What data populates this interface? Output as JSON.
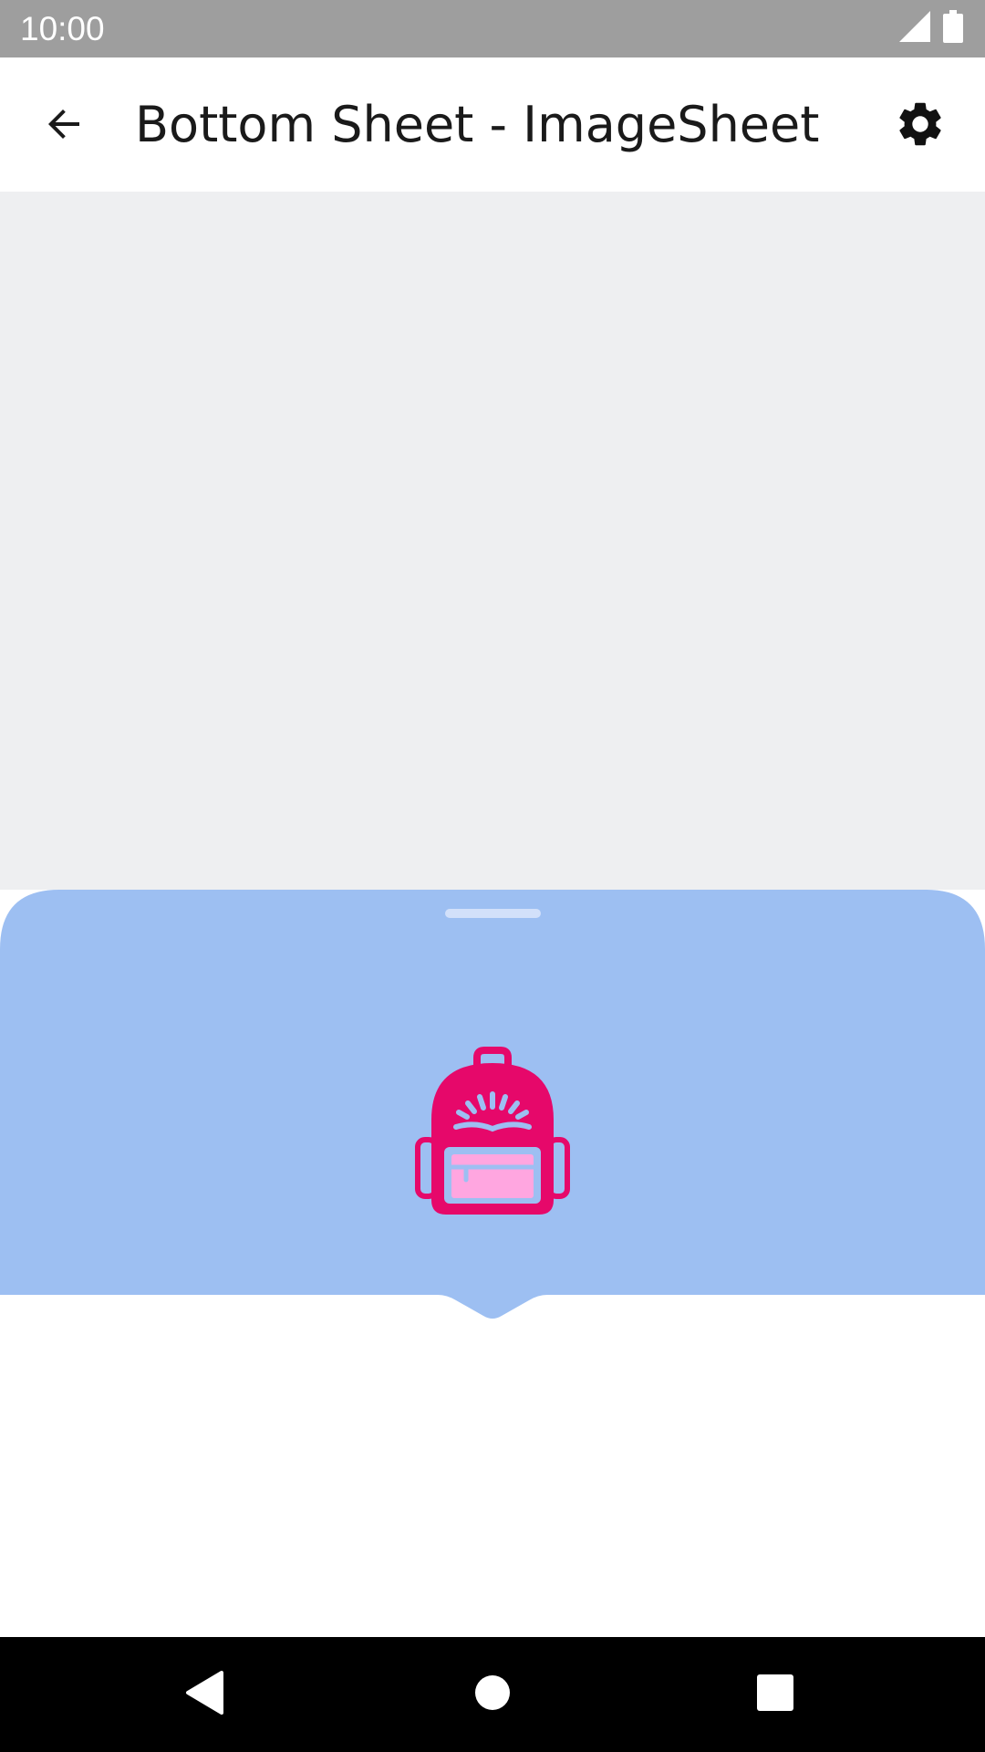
{
  "status_bar": {
    "time": "10:00",
    "signal_icon": "cell-signal-icon",
    "battery_icon": "battery-icon",
    "background": "#9e9e9e"
  },
  "app_bar": {
    "title": "Bottom Sheet - ImageSheet",
    "back_icon": "arrow-back-icon",
    "settings_icon": "gear-icon"
  },
  "content": {
    "background": "#eeeff1"
  },
  "bottom_sheet": {
    "background": "#9dbff2",
    "lower_background": "#ffffff",
    "handle_color": "#d2e0fa",
    "image_icon": "backpack-icon",
    "image_primary_color": "#e6086a",
    "image_secondary_color": "#ffa6e0"
  },
  "nav_bar": {
    "back_icon": "nav-back-icon",
    "home_icon": "nav-home-icon",
    "recents_icon": "nav-recents-icon"
  }
}
